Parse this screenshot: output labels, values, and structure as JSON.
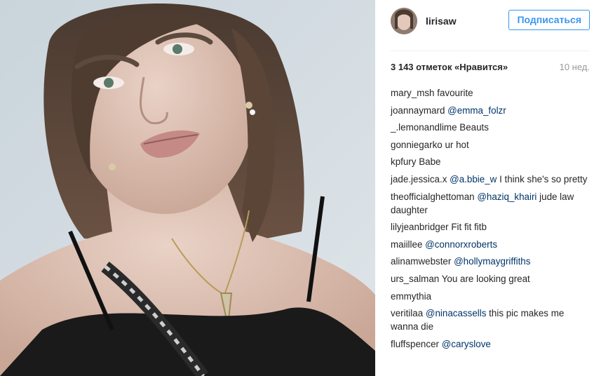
{
  "post": {
    "author": "lirisaw",
    "follow_label": "Подписаться",
    "likes": "3 143 отметок «Нравится»",
    "time": "10 нед."
  },
  "comments": [
    {
      "user": "mary_msh",
      "mention": "",
      "text": "favourite"
    },
    {
      "user": "joannaymard",
      "mention": "@emma_folzr",
      "text": ""
    },
    {
      "user": "_.lemonandlime",
      "mention": "",
      "text": "Beauts"
    },
    {
      "user": "gonniegarko",
      "mention": "",
      "text": "ur hot"
    },
    {
      "user": "kpfury",
      "mention": "",
      "text": "Babe"
    },
    {
      "user": "jade.jessica.x",
      "mention": "@a.bbie_w",
      "text": "I think she's so pretty"
    },
    {
      "user": "theofficialghettoman",
      "mention": "@haziq_khairi",
      "text": "jude law daughter"
    },
    {
      "user": "lilyjeanbridger",
      "mention": "",
      "text": "Fit fit fitb"
    },
    {
      "user": "maiillee",
      "mention": "@connorxroberts",
      "text": ""
    },
    {
      "user": "alinamwebster",
      "mention": "@hollymaygriffiths",
      "text": ""
    },
    {
      "user": "urs_salman",
      "mention": "",
      "text": "You are looking great"
    },
    {
      "user": "emmythia",
      "mention": "",
      "text": ""
    },
    {
      "user": "veritilaa",
      "mention": "@ninacassells",
      "text": "this pic makes me wanna die"
    },
    {
      "user": "fluffspencer",
      "mention": "@caryslove",
      "text": ""
    }
  ]
}
